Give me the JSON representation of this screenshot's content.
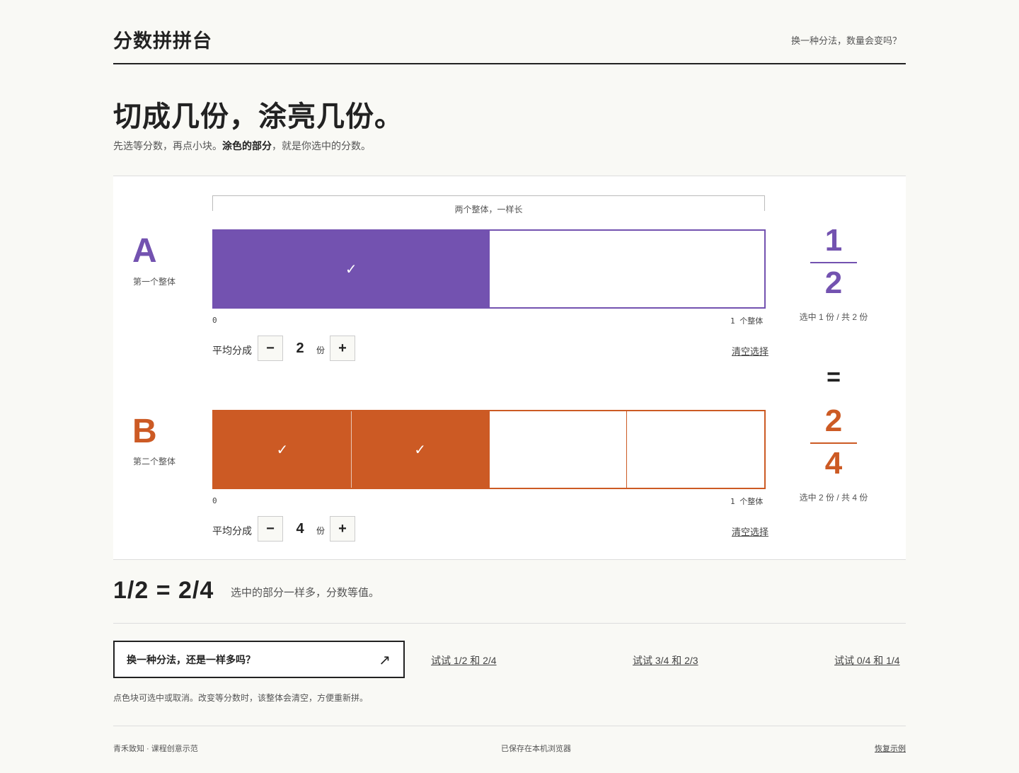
{
  "header": {
    "brand": "分数拼拼台",
    "link": "换一种分法，数量会变吗？"
  },
  "hero": {
    "title": "切成几份，涂亮几份。",
    "sub_pre": "先选等分数，再点小块。",
    "sub_bold": "涂色的部分",
    "sub_post": "，就是你选中的分数。"
  },
  "panel": {
    "same_length_label": "两个整体，一样长"
  },
  "colors": {
    "a": "#7352b0",
    "b": "#cc5a24"
  },
  "wholes": [
    {
      "letter": "A",
      "name": "第一个整体",
      "parts": 2,
      "selected": [
        true,
        false
      ],
      "scale_start": "0",
      "scale_end": "1 个整体",
      "ctrl_label": "平均分成",
      "count": "2",
      "unit": "份",
      "minus": "−",
      "plus": "+",
      "clear": "清空选择",
      "numerator": "1",
      "denominator": "2",
      "caption": "选中 1 份 / 共 2 份",
      "check": "✓"
    },
    {
      "letter": "B",
      "name": "第二个整体",
      "parts": 4,
      "selected": [
        true,
        true,
        false,
        false
      ],
      "scale_start": "0",
      "scale_end": "1 个整体",
      "ctrl_label": "平均分成",
      "count": "4",
      "unit": "份",
      "minus": "−",
      "plus": "+",
      "clear": "清空选择",
      "numerator": "2",
      "denominator": "4",
      "caption": "选中 2 份 / 共 4 份",
      "check": "✓"
    }
  ],
  "equals_sign": "=",
  "result": {
    "equation": "1/2 = 2/4",
    "text": "选中的部分一样多，分数等值。"
  },
  "challenge": {
    "label": "换一种分法，还是一样多吗？",
    "arrow": "↗"
  },
  "try_links": [
    "试试 1/2 和 2/4",
    "试试 3/4 和 2/3",
    "试试 0/4 和 1/4"
  ],
  "note": "点色块可选中或取消。改变等分数时，该整体会清空，方便重新拼。",
  "footer": {
    "left": "青禾致知 · 课程创意示范",
    "middle": "已保存在本机浏览器",
    "right": "恢复示例"
  }
}
